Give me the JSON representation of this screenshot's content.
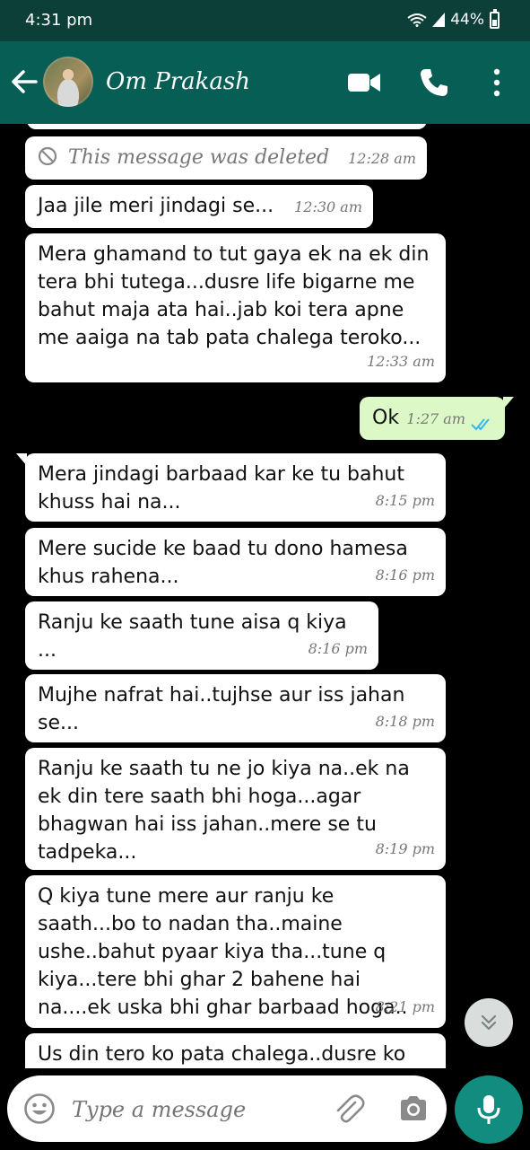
{
  "status_bar": {
    "time": "4:31 pm",
    "battery": "44%"
  },
  "header": {
    "contact_name": "Om Prakash"
  },
  "messages": [
    {
      "text": "This message was deleted",
      "time": "12:28 am",
      "kind": "deleted"
    },
    {
      "text": "Jaa jile meri jindagi se...",
      "time": "12:30 am"
    },
    {
      "text": "Mera ghamand to tut gaya ek na ek din tera bhi tutega...dusre life bigarne me bahut maja ata hai..jab koi tera apne me aaiga na tab pata chalega teroko...",
      "time": "12:33 am"
    },
    {
      "text": "Ok",
      "time": "1:27 am",
      "kind": "outgoing"
    },
    {
      "text": "Mera jindagi barbaad kar ke tu bahut khuss hai na...",
      "time": "8:15 pm"
    },
    {
      "text": "Mere sucide ke baad tu dono hamesa khus rahena...",
      "time": "8:16 pm"
    },
    {
      "text": "Ranju ke saath tune aisa q kiya ...",
      "time": "8:16 pm"
    },
    {
      "text": "Mujhe nafrat hai..tujhse aur iss jahan se...",
      "time": "8:18 pm"
    },
    {
      "text": "Ranju ke saath tu ne jo kiya na..ek na ek din tere saath bhi hoga...agar bhagwan hai iss jahan..mere se tu tadpeka...",
      "time": "8:19 pm"
    },
    {
      "text": "Q kiya tune mere aur ranju ke saath...bo to nadan tha..maine ushe..bahut pyaar kiya tha...tune q kiya...tere bhi ghar 2 bahene hai na....ek uska bhi ghar barbaad hoga..",
      "time": "8:21 pm"
    },
    {
      "text": "Us din tero ko pata chalega..dusre ko",
      "time": ""
    }
  ],
  "input": {
    "placeholder": "Type a message"
  },
  "colors": {
    "header": "#075e54",
    "status_bar": "#0b3f38",
    "incoming_bubble": "#ffffff",
    "outgoing_bubble": "#dcf8c6",
    "read_ticks": "#34b7f1",
    "mic_button": "#128c7e"
  },
  "icons": [
    "back-arrow-icon",
    "video-call-icon",
    "phone-icon",
    "more-options-icon",
    "deleted-icon",
    "read-ticks-icon",
    "chevron-down-icon",
    "emoji-icon",
    "attach-icon",
    "camera-icon",
    "mic-icon",
    "wifi-icon",
    "signal-icon",
    "battery-icon"
  ]
}
